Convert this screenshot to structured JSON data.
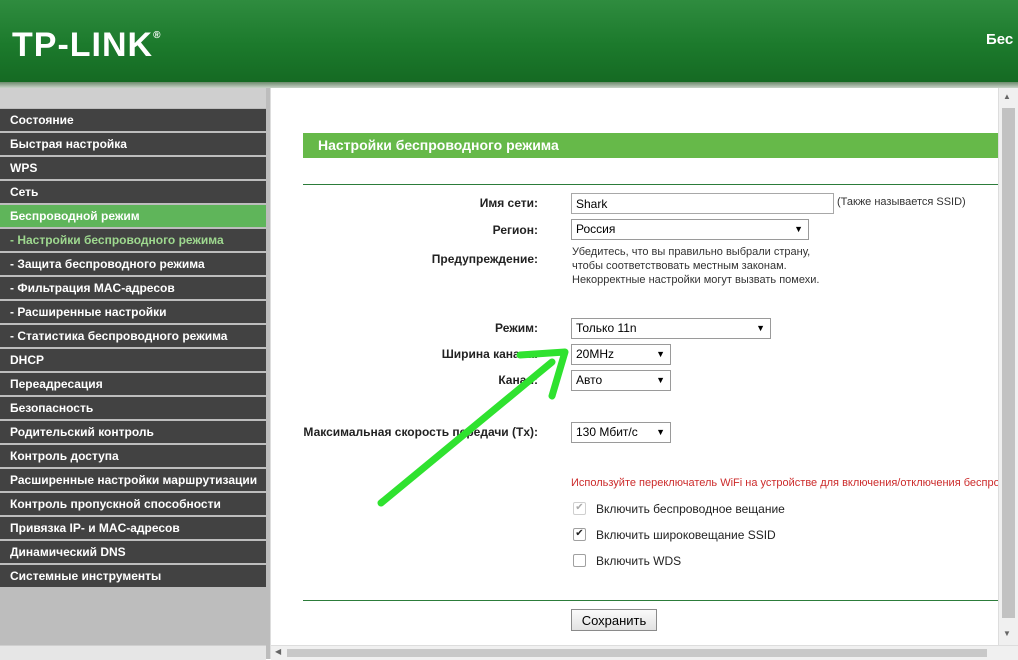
{
  "header": {
    "logo_text": "TP-LINK",
    "logo_mark": "®",
    "right_text": "Бес"
  },
  "sidebar": {
    "items": [
      {
        "label": "Состояние",
        "state": "normal"
      },
      {
        "label": "Быстрая настройка",
        "state": "normal"
      },
      {
        "label": "WPS",
        "state": "normal"
      },
      {
        "label": "Сеть",
        "state": "normal"
      },
      {
        "label": "Беспроводной режим",
        "state": "active"
      },
      {
        "label": "- Настройки беспроводного режима",
        "state": "sub-active"
      },
      {
        "label": "- Защита беспроводного режима",
        "state": "normal"
      },
      {
        "label": "- Фильтрация MAC-адресов",
        "state": "normal"
      },
      {
        "label": "- Расширенные настройки",
        "state": "normal"
      },
      {
        "label": "- Статистика беспроводного режима",
        "state": "normal"
      },
      {
        "label": "DHCP",
        "state": "normal"
      },
      {
        "label": "Переадресация",
        "state": "normal"
      },
      {
        "label": "Безопасность",
        "state": "normal"
      },
      {
        "label": "Родительский контроль",
        "state": "normal"
      },
      {
        "label": "Контроль доступа",
        "state": "normal"
      },
      {
        "label": "Расширенные настройки маршрутизации",
        "state": "normal"
      },
      {
        "label": "Контроль пропускной способности",
        "state": "normal"
      },
      {
        "label": "Привязка IP- и MAC-адресов",
        "state": "normal"
      },
      {
        "label": "Динамический DNS",
        "state": "normal"
      },
      {
        "label": "Системные инструменты",
        "state": "normal"
      }
    ]
  },
  "main": {
    "title": "Настройки беспроводного режима",
    "ssid": {
      "label": "Имя сети:",
      "value": "Shark",
      "hint": "(Также называется SSID)"
    },
    "region": {
      "label": "Регион:",
      "value": "Россия"
    },
    "warning": {
      "label": "Предупреждение:",
      "lines": [
        "Убедитесь, что вы правильно выбрали страну,",
        "чтобы соответствовать местным законам.",
        "Некорректные настройки могут вызвать помехи."
      ]
    },
    "mode": {
      "label": "Режим:",
      "value": "Только 11n"
    },
    "channel_width": {
      "label": "Ширина канала:",
      "value": "20MHz"
    },
    "channel": {
      "label": "Канал:",
      "value": "Авто"
    },
    "max_tx_rate": {
      "label": "Максимальная скорость передачи (Tx):",
      "value": "130 Мбит/с"
    },
    "wifi_switch_note": "Используйте переключатель WiFi на устройстве для включения/отключения беспроводного вещания.",
    "checkboxes": [
      {
        "label": "Включить беспроводное вещание",
        "checked": true,
        "disabled": true
      },
      {
        "label": "Включить широковещание SSID",
        "checked": true,
        "disabled": false
      },
      {
        "label": "Включить WDS",
        "checked": false,
        "disabled": false
      }
    ],
    "save_label": "Сохранить"
  },
  "icons": {
    "dropdown": "chevron-down-icon",
    "annotation": "green-arrow-icon"
  },
  "colors": {
    "header_green": "#1c7a2c",
    "menu_dark": "#424242",
    "menu_active": "#5fb55a",
    "title_bar": "#66b949",
    "warning_red": "#cc2b2b",
    "annotation_arrow": "#2fe22f"
  }
}
